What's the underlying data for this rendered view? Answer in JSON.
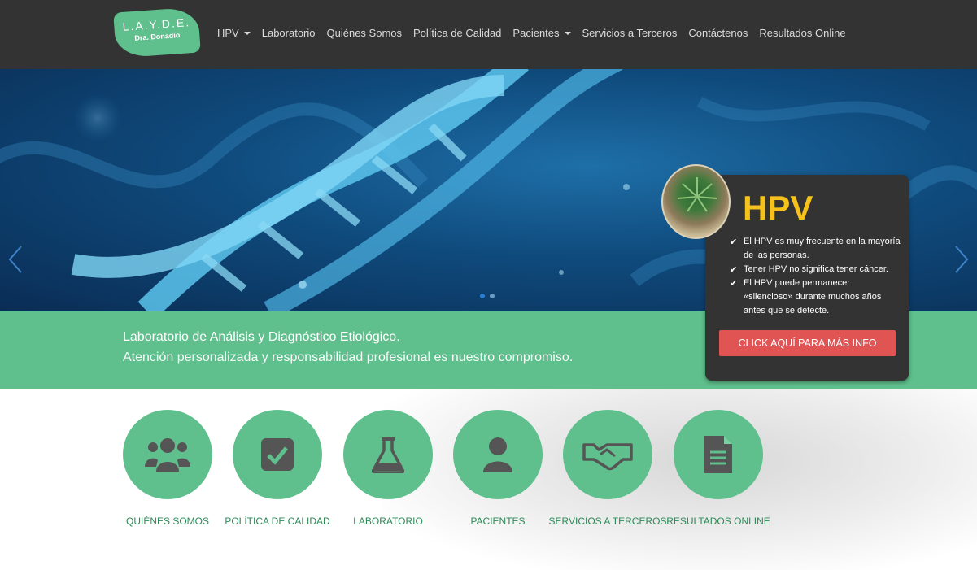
{
  "logo": {
    "title": "L.A.Y.D.E.",
    "subtitle": "Dra. Donadío"
  },
  "nav": {
    "items": [
      {
        "label": "HPV",
        "dropdown": true
      },
      {
        "label": "Laboratorio",
        "dropdown": false
      },
      {
        "label": "Quiénes Somos",
        "dropdown": false
      },
      {
        "label": "Política de Calidad",
        "dropdown": false
      },
      {
        "label": "Pacientes",
        "dropdown": true
      },
      {
        "label": "Servicios a Terceros",
        "dropdown": false
      },
      {
        "label": "Contáctenos",
        "dropdown": false
      },
      {
        "label": "Resultados Online",
        "dropdown": false
      }
    ]
  },
  "hero": {
    "slide_count": 2,
    "active_slide": 1
  },
  "band": {
    "line1": "Laboratorio de Análisis y Diagnóstico Etiológico.",
    "line2": "Atención personalizada y responsabilidad profesional es nuestro compromiso."
  },
  "hpv_card": {
    "title": "HPV",
    "items": [
      "El HPV es muy frecuente en la mayoría de las personas.",
      "Tener HPV no significa tener cáncer.",
      "El HPV puede permanecer «silencioso» durante muchos años antes que se detecte."
    ],
    "button": "CLICK AQUÍ PARA MÁS INFO"
  },
  "features": [
    {
      "icon": "users-icon",
      "label": "QUIÉNES SOMOS"
    },
    {
      "icon": "checkbox-icon",
      "label": "POLÍTICA DE CALIDAD"
    },
    {
      "icon": "flask-icon",
      "label": "LABORATORIO"
    },
    {
      "icon": "user-icon",
      "label": "PACIENTES"
    },
    {
      "icon": "handshake-icon",
      "label": "SERVICIOS A TERCEROS"
    },
    {
      "icon": "document-icon",
      "label": "RESULTADOS ONLINE"
    }
  ],
  "colors": {
    "nav_bg": "#333333",
    "brand_green": "#5fc08d",
    "label_green": "#2d8a57",
    "hpv_yellow": "#f4c21b",
    "cta_red": "#e05454",
    "icon_dark": "#555555"
  }
}
